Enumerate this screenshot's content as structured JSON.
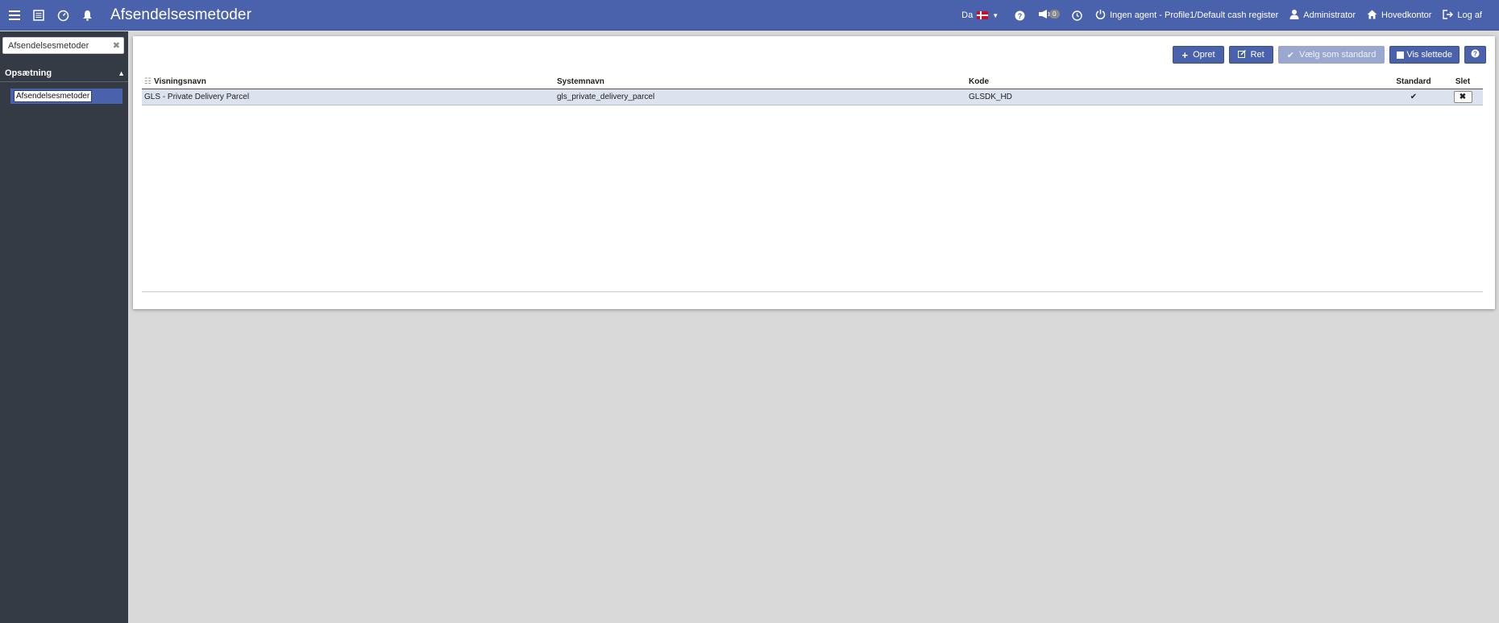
{
  "topbar": {
    "title": "Afsendelsesmetoder",
    "language": "Da",
    "notification_count": "0",
    "agent_text": "Ingen agent - Profile1/Default cash register",
    "user": "Administrator",
    "office": "Hovedkontor",
    "logout": "Log af"
  },
  "sidebar": {
    "search_value": "Afsendelsesmetoder",
    "section": "Opsætning",
    "items": [
      {
        "label": "Afsendelsesmetoder"
      }
    ]
  },
  "toolbar": {
    "create": "Opret",
    "edit": "Ret",
    "set_default": "Vælg som standard",
    "show_deleted": "Vis slettede"
  },
  "table": {
    "headers": {
      "display_name": "Visningsnavn",
      "system_name": "Systemnavn",
      "code": "Kode",
      "standard": "Standard",
      "delete": "Slet"
    },
    "rows": [
      {
        "display_name": "GLS - Private Delivery Parcel",
        "system_name": "gls_private_delivery_parcel",
        "code": "GLSDK_HD",
        "standard": "✔"
      }
    ]
  },
  "colors": {
    "accent": "#4a62ab",
    "sidebar": "#343b44",
    "background": "#d9d9d9",
    "row_selected": "#dde2ef"
  }
}
